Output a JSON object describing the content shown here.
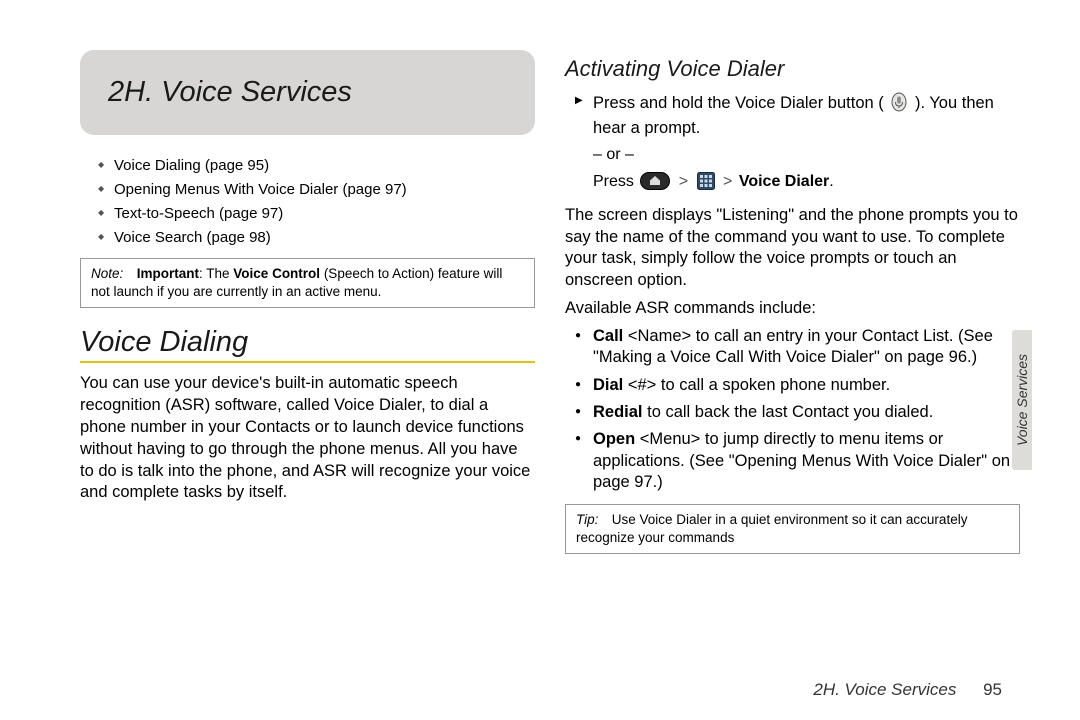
{
  "chapter": {
    "title": "2H. Voice Services"
  },
  "toc": {
    "items": [
      "Voice Dialing (page 95)",
      "Opening Menus With Voice Dialer (page 97)",
      "Text-to-Speech (page 97)",
      "Voice Search (page 98)"
    ]
  },
  "note": {
    "label": "Note:",
    "bold1": "Important",
    "text1": ": The ",
    "bold2": "Voice Control",
    "text2": " (Speech to Action) feature will not launch if you are currently in an active menu."
  },
  "section1": {
    "heading": "Voice Dialing",
    "body": "You can use your device's built-in automatic speech recognition (ASR) software, called Voice Dialer, to dial a phone number in your Contacts or to launch device functions without having to go through the phone menus. All you have to do is talk into the phone, and ASR will recognize your voice and complete tasks by itself."
  },
  "section2": {
    "heading": "Activating Voice Dialer",
    "step1a": "Press and hold the Voice Dialer button (",
    "step1b": "). You then hear a prompt.",
    "or": "– or –",
    "press": "Press ",
    "press_end": "Voice Dialer",
    "period": ".",
    "body2": "The screen displays \"Listening\" and the phone prompts you to say the name of the command you want to use. To complete your task, simply follow the voice prompts or touch an onscreen option.",
    "body3": "Available ASR commands include:",
    "cmds": [
      {
        "b": "Call",
        "rest": " <Name> to call an entry in your Contact List. (See \"Making a Voice Call With Voice Dialer\" on page 96.)"
      },
      {
        "b": "Dial",
        "rest": " <#> to call a spoken phone number."
      },
      {
        "b": "Redial",
        "rest": " to call back the last Contact you dialed."
      },
      {
        "b": "Open",
        "rest": " <Menu> to jump directly to menu items or applications. (See \"Opening Menus With Voice Dialer\" on page 97.)"
      }
    ]
  },
  "tip": {
    "label": "Tip:",
    "text": "Use Voice Dialer in a quiet environment so it can accurately recognize your commands"
  },
  "sidetab": "Voice Services",
  "footer": {
    "chapter": "2H. Voice Services",
    "page": "95"
  },
  "icons": {
    "voice_button": "voice-dialer-hw-button-icon",
    "home": "home-button-icon",
    "grid": "app-grid-icon"
  }
}
